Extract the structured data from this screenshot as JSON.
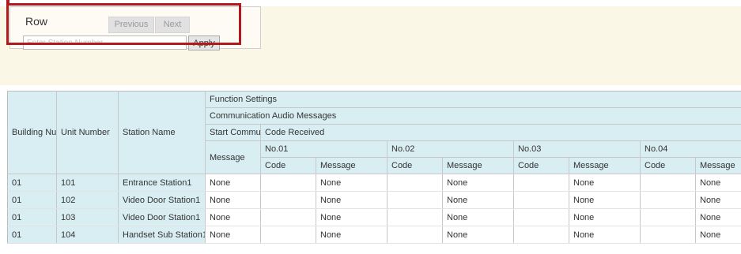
{
  "row_panel": {
    "title": "Row",
    "previous_label": "Previous",
    "next_label": "Next",
    "station_placeholder": "Enter Station Number",
    "apply_label": "Apply"
  },
  "table": {
    "headers": {
      "building": "Building Nu",
      "unit": "Unit Number",
      "station": "Station Name",
      "function_settings": "Function Settings",
      "comm_audio": "Communication Audio Messages",
      "start_commu": "Start Commu",
      "code_received": "Code Received",
      "message": "Message",
      "groups": [
        "No.01",
        "No.02",
        "No.03",
        "No.04"
      ],
      "code": "Code",
      "sub_message": "Message"
    },
    "rows": [
      {
        "building": "01",
        "unit": "101",
        "station": "Entrance Station1",
        "start_msg": "None",
        "c1": "",
        "m1": "None",
        "c2": "",
        "m2": "None",
        "c3": "",
        "m3": "None",
        "c4": "",
        "m4": "None"
      },
      {
        "building": "01",
        "unit": "102",
        "station": "Video Door Station1",
        "start_msg": "None",
        "c1": "",
        "m1": "None",
        "c2": "",
        "m2": "None",
        "c3": "",
        "m3": "None",
        "c4": "",
        "m4": "None"
      },
      {
        "building": "01",
        "unit": "103",
        "station": "Video Door Station1",
        "start_msg": "None",
        "c1": "",
        "m1": "None",
        "c2": "",
        "m2": "None",
        "c3": "",
        "m3": "None",
        "c4": "",
        "m4": "None"
      },
      {
        "building": "01",
        "unit": "104",
        "station": "Handset Sub Station1",
        "start_msg": "None",
        "c1": "",
        "m1": "None",
        "c2": "",
        "m2": "None",
        "c3": "",
        "m3": "None",
        "c4": "",
        "m4": "None"
      }
    ]
  },
  "colors": {
    "banner": "#fbf7e6",
    "header_cell": "#d9eef2",
    "callout": "#b2191f"
  }
}
